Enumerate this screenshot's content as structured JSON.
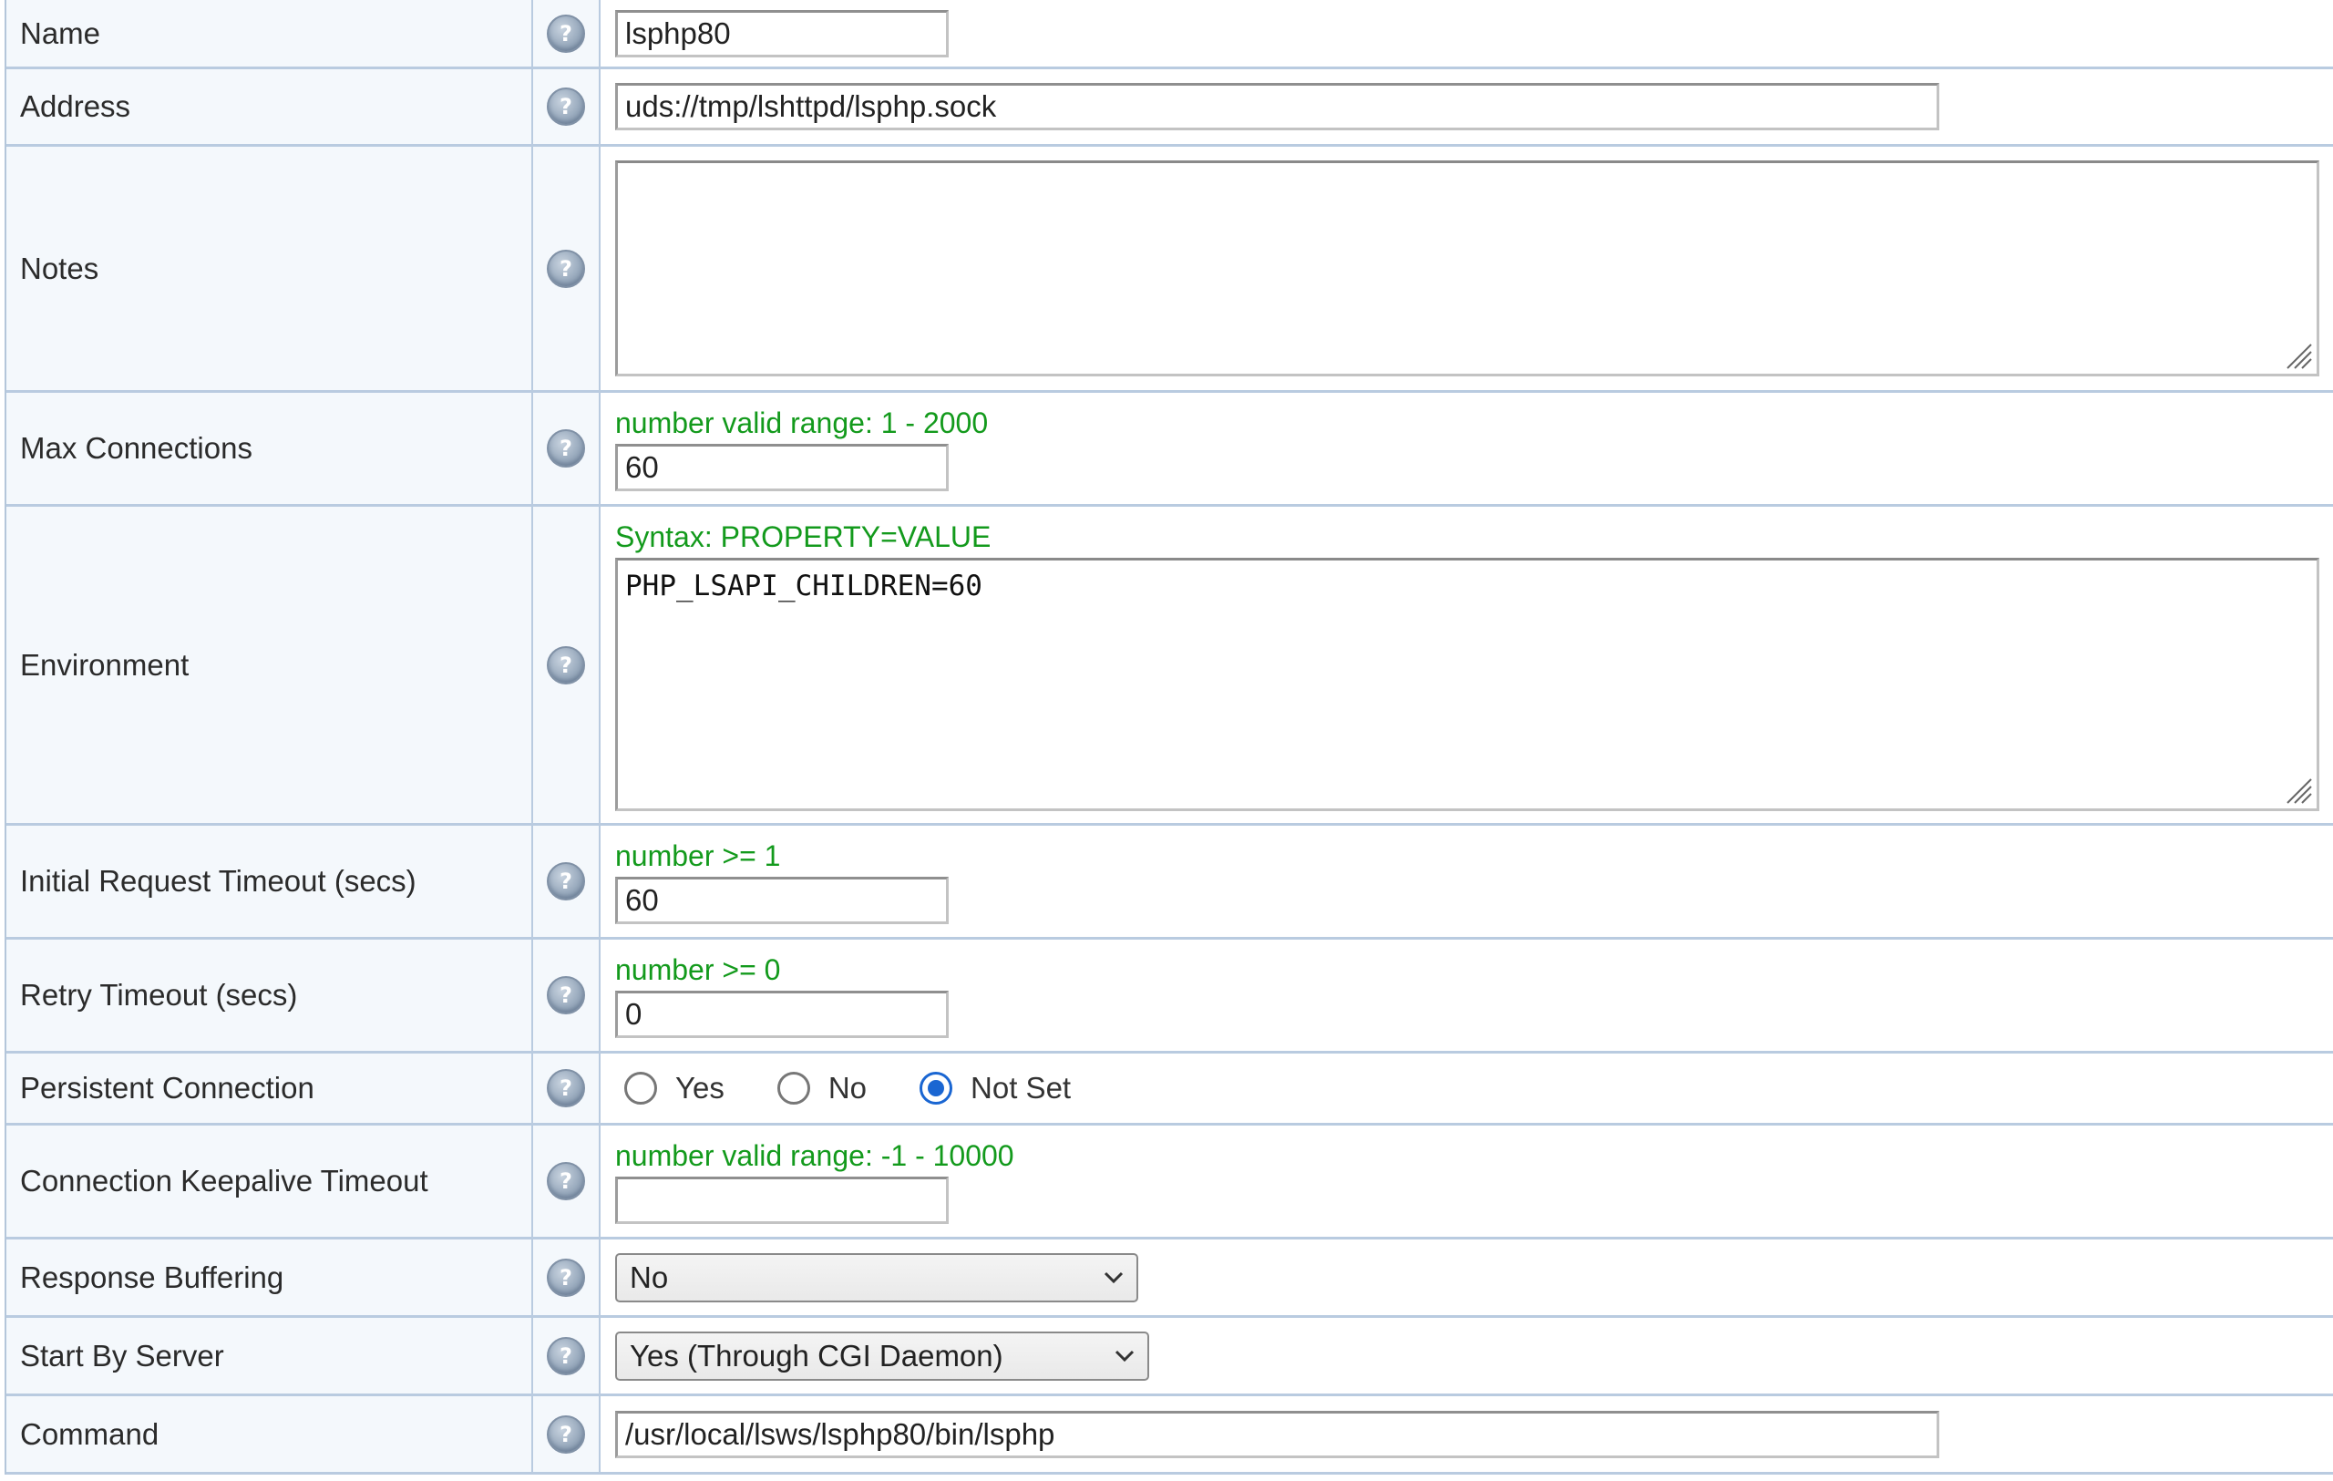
{
  "rows": [
    {
      "label": "Name",
      "value": "lsphp80"
    },
    {
      "label": "Address",
      "value": "uds://tmp/lshttpd/lsphp.sock"
    },
    {
      "label": "Notes",
      "value": ""
    },
    {
      "label": "Max Connections",
      "hint": "number valid range: 1 - 2000",
      "value": "60"
    },
    {
      "label": "Environment",
      "hint": "Syntax: PROPERTY=VALUE",
      "value": "PHP_LSAPI_CHILDREN=60"
    },
    {
      "label": "Initial Request Timeout (secs)",
      "hint": "number >= 1",
      "value": "60"
    },
    {
      "label": "Retry Timeout (secs)",
      "hint": "number >= 0",
      "value": "0"
    },
    {
      "label": "Persistent Connection",
      "options": [
        "Yes",
        "No",
        "Not Set"
      ],
      "selected": "Not Set"
    },
    {
      "label": "Connection Keepalive Timeout",
      "hint": "number valid range: -1 - 10000",
      "value": ""
    },
    {
      "label": "Response Buffering",
      "value": "No"
    },
    {
      "label": "Start By Server",
      "value": "Yes (Through CGI Daemon)"
    },
    {
      "label": "Command",
      "value": "/usr/local/lsws/lsphp80/bin/lsphp"
    }
  ],
  "help_icon": "question-mark-circle",
  "colors": {
    "hint_green": "#139a1c",
    "label_bg": "#f4f8fc",
    "border": "#b9cbe0",
    "radio_accent": "#1a66d2"
  }
}
